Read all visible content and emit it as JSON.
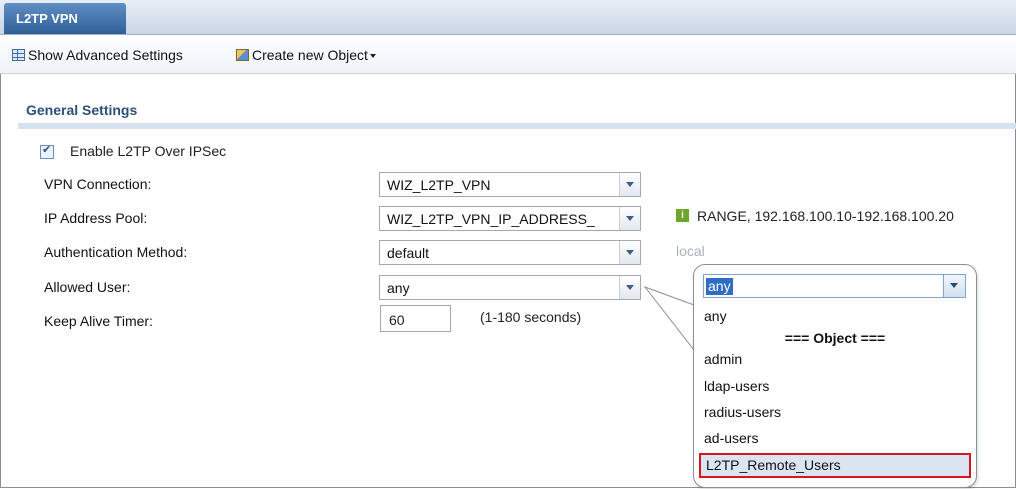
{
  "window": {
    "tab_title": "L2TP VPN"
  },
  "toolbar": {
    "show_advanced_label": "Show Advanced Settings",
    "create_object_label": "Create new Object"
  },
  "section": {
    "title": "General Settings"
  },
  "form": {
    "enable_label": "Enable L2TP Over IPSec",
    "enable_checked": true,
    "vpn_connection": {
      "label": "VPN Connection:",
      "value": "WIZ_L2TP_VPN"
    },
    "ip_pool": {
      "label": "IP Address Pool:",
      "value": "WIZ_L2TP_VPN_IP_ADDRESS_",
      "info": "RANGE, 192.168.100.10-192.168.100.20"
    },
    "auth_method": {
      "label": "Authentication Method:",
      "value": "default",
      "note": "local"
    },
    "allowed_user": {
      "label": "Allowed User:",
      "value": "any"
    },
    "keep_alive": {
      "label": "Keep Alive Timer:",
      "value": "60",
      "hint": "(1-180 seconds)"
    }
  },
  "dropdown": {
    "selected": "any",
    "options": [
      "any",
      "admin",
      "ldap-users",
      "radius-users",
      "ad-users"
    ],
    "group_header": "=== Object ===",
    "highlighted": "L2TP_Remote_Users"
  },
  "colors": {
    "tab_bg": "#3b6ea5",
    "section_title": "#2c4f7c",
    "highlight_border": "#d7161f",
    "selection_bg": "#2f6dc0"
  }
}
